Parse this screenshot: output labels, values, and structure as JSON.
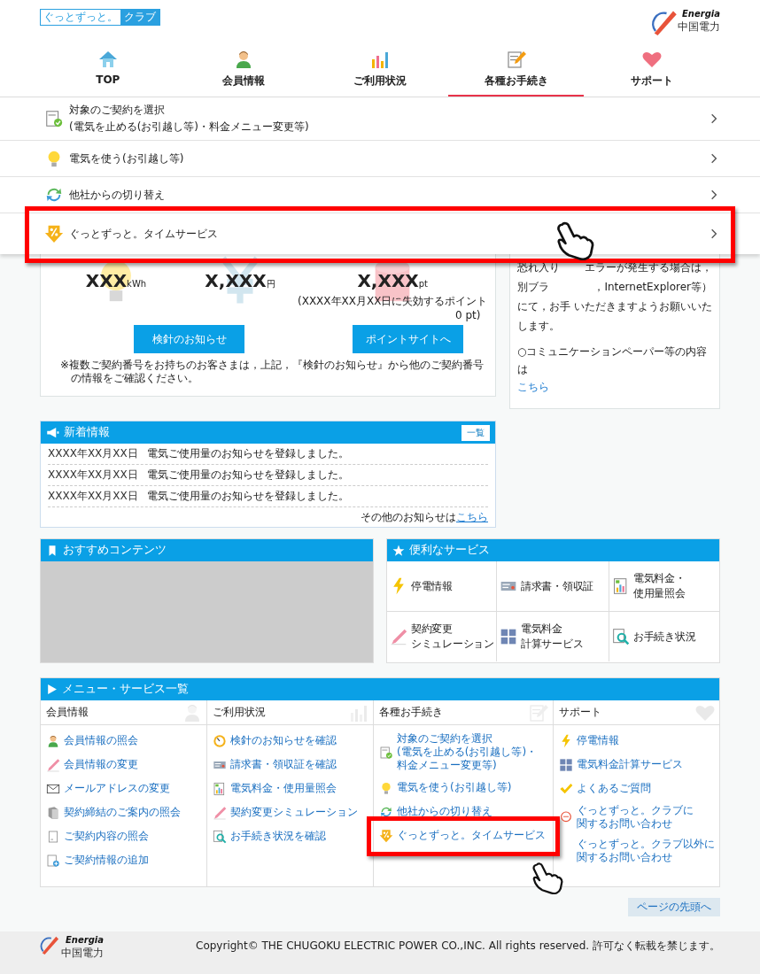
{
  "header": {
    "logo": {
      "part1": "ぐっとずっと。",
      "part2": "クラブ"
    },
    "brand": {
      "name": "Energia",
      "sub": "中国電力"
    }
  },
  "nav": [
    {
      "label": "TOP",
      "selected": false
    },
    {
      "label": "会員情報",
      "selected": false
    },
    {
      "label": "ご利用状況",
      "selected": false
    },
    {
      "label": "各種お手続き",
      "selected": true
    },
    {
      "label": "サポート",
      "selected": false
    }
  ],
  "dropdown": {
    "items": [
      {
        "lines": [
          "対象のご契約を選択",
          "(電気を止める(お引越し等)・料金メニュー変更等)"
        ],
        "highlighted": false
      },
      {
        "lines": [
          "電気を使う(お引越し等)"
        ],
        "highlighted": false
      },
      {
        "lines": [
          "他社からの切り替え"
        ],
        "highlighted": false
      },
      {
        "lines": [
          "ぐっとずっと。タイムサービス"
        ],
        "highlighted": true
      }
    ]
  },
  "summary": {
    "stats": [
      {
        "value": "XXX",
        "unit": "kWh"
      },
      {
        "value": "X,XXX",
        "unit": "円"
      },
      {
        "value": "X,XXX",
        "unit": "pt"
      }
    ],
    "expiry": [
      "(XXXX年XX月XX日に失効するポイント",
      "0 pt)"
    ],
    "buttons": [
      "検針のお知らせ",
      "ポイントサイトへ"
    ],
    "note": "※複数ご契約番号をお持ちのお客さまは，上記，『検針のお知らせ』から他のご契約番号の情報をご確認ください。"
  },
  "notice": {
    "lines": [
      {
        "left": "恐れ入り",
        "right": "エラーが発生する場合は，"
      },
      {
        "left": "別ブラ",
        "right": "，InternetExplorer等）"
      },
      {
        "left": "にて，お手",
        "right": "いただきますようお願いいた"
      },
      {
        "left": "します。"
      }
    ],
    "comm": {
      "text": "○コミュニケーションペーパー等の内容は",
      "link": "こちら"
    }
  },
  "news": {
    "title": "新着情報",
    "all_button": "一覧",
    "items": [
      {
        "date": "XXXX年XX月XX日",
        "text": "電気ご使用量のお知らせを登録しました。"
      },
      {
        "date": "XXXX年XX月XX日",
        "text": "電気ご使用量のお知らせを登録しました。"
      },
      {
        "date": "XXXX年XX月XX日",
        "text": "電気ご使用量のお知らせを登録しました。"
      }
    ],
    "more": {
      "text": "その他のお知らせは",
      "link": "こちら"
    }
  },
  "recommended": {
    "title": "おすすめコンテンツ"
  },
  "services": {
    "title": "便利なサービス",
    "items": [
      {
        "lines": [
          "停電情報"
        ]
      },
      {
        "lines": [
          "請求書・領収証"
        ]
      },
      {
        "lines": [
          "電気料金・",
          "使用量照会"
        ]
      },
      {
        "lines": [
          "契約変更",
          "シミュレーション"
        ]
      },
      {
        "lines": [
          "電気料金",
          "計算サービス"
        ]
      },
      {
        "lines": [
          "お手続き状況"
        ]
      }
    ]
  },
  "menu": {
    "title": "メニュー・サービス一覧",
    "columns": [
      {
        "title": "会員情報",
        "items": [
          {
            "lines": [
              "会員情報の照会"
            ],
            "highlighted": false
          },
          {
            "lines": [
              "会員情報の変更"
            ],
            "highlighted": false
          },
          {
            "lines": [
              "メールアドレスの変更"
            ],
            "highlighted": false
          },
          {
            "lines": [
              "契約締結のご案内の照会"
            ],
            "highlighted": false
          },
          {
            "lines": [
              "ご契約内容の照会"
            ],
            "highlighted": false
          },
          {
            "lines": [
              "ご契約情報の追加"
            ],
            "highlighted": false
          }
        ]
      },
      {
        "title": "ご利用状況",
        "items": [
          {
            "lines": [
              "検針のお知らせを確認"
            ],
            "highlighted": false
          },
          {
            "lines": [
              "請求書・領収証を確認"
            ],
            "highlighted": false
          },
          {
            "lines": [
              "電気料金・使用量照会"
            ],
            "highlighted": false
          },
          {
            "lines": [
              "契約変更シミュレーション"
            ],
            "highlighted": false
          },
          {
            "lines": [
              "お手続き状況を確認"
            ],
            "highlighted": false
          }
        ]
      },
      {
        "title": "各種お手続き",
        "items": [
          {
            "lines": [
              "対象のご契約を選択",
              "(電気を止める(お引越し等)・",
              "料金メニュー変更等)"
            ],
            "highlighted": false
          },
          {
            "lines": [
              "電気を使う(お引越し等)"
            ],
            "highlighted": false
          },
          {
            "lines": [
              "他社からの切り替え"
            ],
            "highlighted": false
          },
          {
            "lines": [
              "ぐっとずっと。タイムサービス"
            ],
            "highlighted": true
          }
        ]
      },
      {
        "title": "サポート",
        "items": [
          {
            "lines": [
              "停電情報"
            ],
            "highlighted": false
          },
          {
            "lines": [
              "電気料金計算サービス"
            ],
            "highlighted": false
          },
          {
            "lines": [
              "よくあるご質問"
            ],
            "highlighted": false
          },
          {
            "lines": [
              "ぐっとずっと。クラブに",
              "関するお問い合わせ"
            ],
            "highlighted": false
          },
          {
            "lines": [
              "ぐっとずっと。クラブ以外に",
              "関するお問い合わせ"
            ],
            "highlighted": false
          }
        ]
      }
    ]
  },
  "back_to_top": "ページの先頭へ",
  "footer": {
    "brand": {
      "name": "Energia",
      "sub": "中国電力"
    },
    "copyright": "Copyright© THE CHUGOKU ELECTRIC POWER CO.,INC. All rights reserved. 許可なく転載を禁じます。"
  }
}
